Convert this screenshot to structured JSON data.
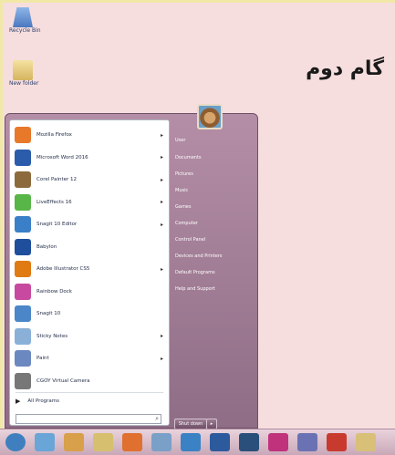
{
  "desktop": {
    "icons": [
      {
        "label": "Recycle Bin",
        "icon": "recycle-bin-icon"
      },
      {
        "label": "New folder",
        "icon": "folder-icon"
      }
    ],
    "step_title": "گام دوم"
  },
  "start_menu": {
    "programs": [
      {
        "label": "Mozilla Firefox",
        "icon": "firefox-icon",
        "color": "#e8782a",
        "arrow": "▸"
      },
      {
        "label": "Microsoft Word 2016",
        "icon": "word-icon",
        "color": "#2b5cab",
        "arrow": "▸"
      },
      {
        "label": "Corel Painter 12",
        "icon": "painter-icon",
        "color": "#8c6a3c",
        "arrow": "▸"
      },
      {
        "label": "LiveEffects 16",
        "icon": "liveeffects-icon",
        "color": "#58b548",
        "arrow": "▸"
      },
      {
        "label": "Snagit 10 Editor",
        "icon": "snagit-editor-icon",
        "color": "#3b7fc8",
        "arrow": "▸"
      },
      {
        "label": "Babylon",
        "icon": "babylon-icon",
        "color": "#1f4e9c",
        "arrow": ""
      },
      {
        "label": "Adobe Illustrator CS5",
        "icon": "illustrator-icon",
        "color": "#e07a12",
        "arrow": "▸"
      },
      {
        "label": "Rainbow Dock",
        "icon": "rainbow-dock-icon",
        "color": "#c84aa0",
        "arrow": ""
      },
      {
        "label": "Snagit 10",
        "icon": "snagit-icon",
        "color": "#4a86c8",
        "arrow": ""
      },
      {
        "label": "Sticky Notes",
        "icon": "sticky-notes-icon",
        "color": "#8ab0d8",
        "arrow": "▸"
      },
      {
        "label": "Paint",
        "icon": "paint-icon",
        "color": "#6c88c0",
        "arrow": "▸"
      },
      {
        "label": "CGOY Virtual Camera",
        "icon": "camera-icon",
        "color": "#777777",
        "arrow": ""
      }
    ],
    "all_programs": "All Programs",
    "search_placeholder": "",
    "right_links": [
      "User",
      "Documents",
      "Pictures",
      "Music",
      "Games",
      "Computer",
      "Control Panel",
      "Devices and Printers",
      "Default Programs",
      "Help and Support"
    ],
    "shutdown_label": "Shut down",
    "shutdown_arrow": "▸"
  },
  "taskbar": {
    "buttons": [
      {
        "icon": "start-orb-icon",
        "color": "#3f7fc0"
      },
      {
        "icon": "ie-icon",
        "color": "#6aa5d8"
      },
      {
        "icon": "media-icon",
        "color": "#d8a04a"
      },
      {
        "icon": "explorer-icon",
        "color": "#d6c070"
      },
      {
        "icon": "firefox-taskbar-icon",
        "color": "#e07030"
      },
      {
        "icon": "paint-taskbar-icon",
        "color": "#7aa0c8"
      },
      {
        "icon": "snagit-taskbar-icon",
        "color": "#3a82c4"
      },
      {
        "icon": "word-taskbar-icon",
        "color": "#2c5a9c"
      },
      {
        "icon": "photoshop-taskbar-icon",
        "color": "#2a4f7a"
      },
      {
        "icon": "indesign-taskbar-icon",
        "color": "#c0327c"
      },
      {
        "icon": "illustrator-taskbar-icon",
        "color": "#6a72b4"
      },
      {
        "icon": "acrobat-taskbar-icon",
        "color": "#c93a2e"
      },
      {
        "icon": "folder-taskbar-icon",
        "color": "#d8c078"
      }
    ]
  }
}
